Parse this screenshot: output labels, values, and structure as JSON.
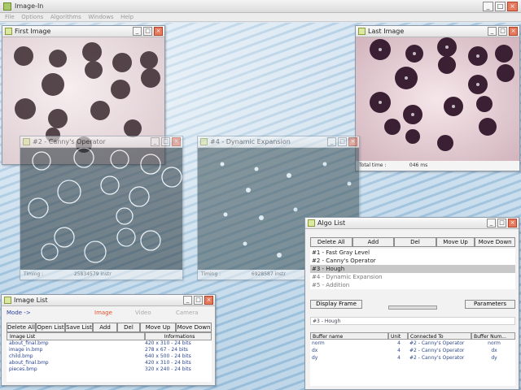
{
  "app": {
    "title": "Image-In"
  },
  "menu": [
    "File",
    "Options",
    "Algorithms",
    "Windows",
    "Help"
  ],
  "window_buttons": {
    "minimize": "_",
    "maximize": "□",
    "close": "×"
  },
  "colors": {
    "accent": "#e57a5e",
    "link": "#2b4592",
    "selection": "#c8c8c8"
  },
  "first_image": {
    "title": "First Image"
  },
  "last_image": {
    "title": "Last Image",
    "timing_label": "Total time :",
    "timing_value": "046 ms"
  },
  "canny": {
    "title": "#2 - Canny's Operator",
    "timing_label": "Timing :",
    "timing_value": "25834579 instr"
  },
  "dynexp": {
    "title": "#4 - Dynamic Expansion",
    "timing_label": "Timing :",
    "timing_value": "6928587 instr"
  },
  "algo_list": {
    "title": "Algo List",
    "buttons": [
      "Delete All",
      "Add",
      "Del",
      "Move Up",
      "Move Down"
    ],
    "items": [
      {
        "label": "#1 - Fast Gray Level",
        "selected": false,
        "dim": false
      },
      {
        "label": "#2 - Canny's Operator",
        "selected": false,
        "dim": false
      },
      {
        "label": "#3 - Hough",
        "selected": true,
        "dim": false
      },
      {
        "label": "#4 - Dynamic Expansion",
        "selected": false,
        "dim": true
      },
      {
        "label": "#5 - Addition",
        "selected": false,
        "dim": true
      }
    ],
    "display_frame": "Display Frame",
    "parameters": "Parameters",
    "current_algo": "#3 - Hough",
    "buffer_headers": [
      "Buffer name",
      "Unit",
      "Connected To",
      "Buffer Num..."
    ],
    "buffers": [
      {
        "name": "norm",
        "unit": "4",
        "connected": "#2 - Canny's Operator",
        "num": "norm"
      },
      {
        "name": "dx",
        "unit": "4",
        "connected": "#2 - Canny's Operator",
        "num": "dx"
      },
      {
        "name": "dy",
        "unit": "4",
        "connected": "#2 - Canny's Operator",
        "num": "dy"
      }
    ]
  },
  "image_list": {
    "title": "Image List",
    "mode_label": "Mode ->",
    "modes": [
      "Image",
      "Video",
      "Camera"
    ],
    "buttons": [
      "Delete All",
      "Open List",
      "Save List",
      "Add",
      "Del",
      "Move Up",
      "Move Down"
    ],
    "headers": [
      "Image List",
      "Informations"
    ],
    "rows": [
      {
        "name": "about_final.bmp",
        "info": "420 x 310 - 24 bits"
      },
      {
        "name": "image in.bmp",
        "info": "278 x 67 - 24 bits"
      },
      {
        "name": "child.bmp",
        "info": "640 x 500 - 24 bits"
      },
      {
        "name": "about_final.bmp",
        "info": "420 x 310 - 24 bits"
      },
      {
        "name": "pieces.bmp",
        "info": "320 x 240 - 24 bits"
      }
    ]
  }
}
